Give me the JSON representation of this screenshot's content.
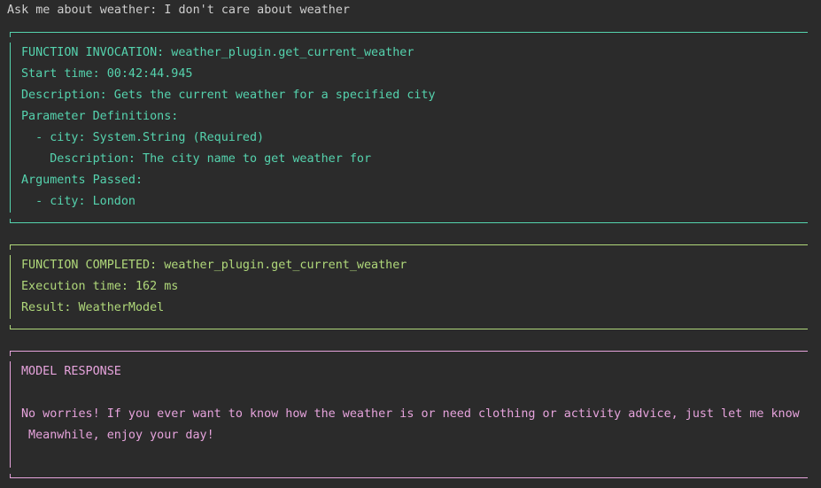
{
  "prompt": {
    "text": "Ask me about weather: I don't care about weather"
  },
  "invocation": {
    "color": "#55d3ae",
    "lines": [
      "FUNCTION INVOCATION: weather_plugin.get_current_weather",
      "Start time: 00:42:44.945",
      "Description: Gets the current weather for a specified city",
      "Parameter Definitions:",
      "  - city: System.String (Required)",
      "    Description: The city name to get weather for",
      "Arguments Passed:",
      "  - city: London"
    ]
  },
  "completed": {
    "color": "#b0d87a",
    "lines": [
      "FUNCTION COMPLETED: weather_plugin.get_current_weather",
      "Execution time: 162 ms",
      "Result: WeatherModel"
    ]
  },
  "model_response": {
    "color": "#e6a3dc",
    "title": "MODEL RESPONSE",
    "lines": [
      "No worries! If you ever want to know how the weather is or need clothing or activity advice, just let me know",
      " Meanwhile, enjoy your day!"
    ]
  }
}
